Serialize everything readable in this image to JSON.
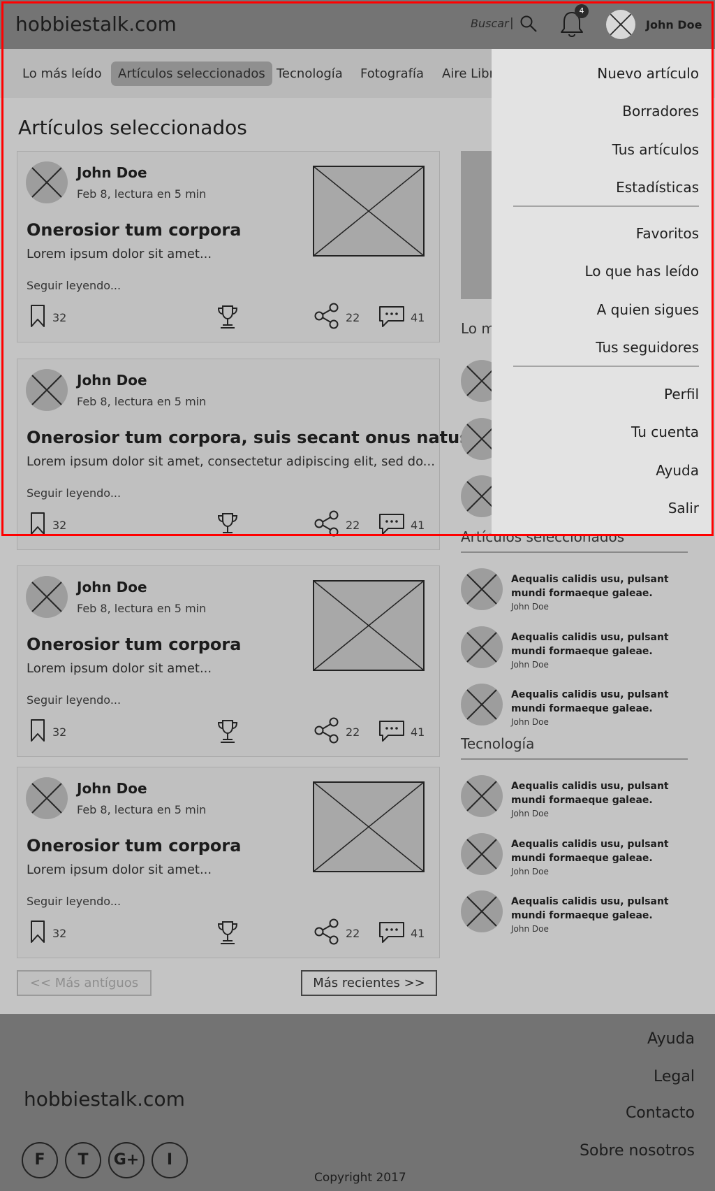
{
  "header": {
    "logo": "hobbiestalk.com",
    "search_label": "Buscar",
    "search_separator": "|",
    "notification_count": "4",
    "user_name": "John Doe"
  },
  "nav": {
    "items": [
      {
        "label": "Lo más leído",
        "active": false
      },
      {
        "label": "Artículos seleccionados",
        "active": true
      },
      {
        "label": "Tecnología",
        "active": false
      },
      {
        "label": "Fotografía",
        "active": false
      },
      {
        "label": "Aire Libre",
        "active": false
      }
    ]
  },
  "main": {
    "title": "Artículos seleccionados",
    "articles": [
      {
        "author": "John Doe",
        "meta": "Feb 8, lectura en 5 min",
        "title": "Onerosior tum corpora",
        "excerpt": "Lorem ipsum dolor sit amet...",
        "read_more": "Seguir leyendo...",
        "bookmarks": "32",
        "shares": "22",
        "comments": "41",
        "has_image": true
      },
      {
        "author": "John Doe",
        "meta": "Feb 8, lectura en 5 min",
        "title": "Onerosior tum corpora, suis secant onus natus",
        "excerpt": "Lorem ipsum dolor sit amet, consectetur adipiscing elit, sed do...",
        "read_more": "Seguir leyendo...",
        "bookmarks": "32",
        "shares": "22",
        "comments": "41",
        "has_image": false
      },
      {
        "author": "John Doe",
        "meta": "Feb 8, lectura en 5 min",
        "title": "Onerosior tum corpora",
        "excerpt": "Lorem ipsum dolor sit amet...",
        "read_more": "Seguir leyendo...",
        "bookmarks": "32",
        "shares": "22",
        "comments": "41",
        "has_image": true
      },
      {
        "author": "John Doe",
        "meta": "Feb 8, lectura en 5 min",
        "title": "Onerosior tum corpora",
        "excerpt": "Lorem ipsum dolor sit amet...",
        "read_more": "Seguir leyendo...",
        "bookmarks": "32",
        "shares": "22",
        "comments": "41",
        "has_image": true
      }
    ],
    "pagination": {
      "older": "<< Más antíguos",
      "newer": "Más recientes >>"
    }
  },
  "sidebar": {
    "sections": [
      {
        "heading": "Lo más leído",
        "items": []
      },
      {
        "heading": "Artículos seleccionados",
        "items": [
          {
            "title": "Aequalis calidis usu, pulsant mundi formaeque galeae.",
            "author": "John Doe"
          },
          {
            "title": "Aequalis calidis usu, pulsant mundi formaeque galeae.",
            "author": "John Doe"
          },
          {
            "title": "Aequalis calidis usu, pulsant mundi formaeque galeae.",
            "author": "John Doe"
          }
        ]
      },
      {
        "heading": "Tecnología",
        "items": [
          {
            "title": "Aequalis calidis usu, pulsant mundi formaeque galeae.",
            "author": "John Doe"
          },
          {
            "title": "Aequalis calidis usu, pulsant mundi formaeque galeae.",
            "author": "John Doe"
          },
          {
            "title": "Aequalis calidis usu, pulsant mundi formaeque galeae.",
            "author": "John Doe"
          }
        ]
      }
    ]
  },
  "user_menu": {
    "groups": [
      [
        "Nuevo artículo",
        "Borradores",
        "Tus artículos",
        "Estadísticas"
      ],
      [
        "Favoritos",
        "Lo que has leído",
        "A quien sigues",
        "Tus seguidores"
      ],
      [
        "Perfil",
        "Tu cuenta",
        "Ayuda",
        "Salir"
      ]
    ]
  },
  "footer": {
    "logo": "hobbiestalk.com",
    "links": [
      "Ayuda",
      "Legal",
      "Contacto",
      "Sobre nosotros"
    ],
    "social": [
      "F",
      "T",
      "G+",
      "I"
    ],
    "copyright": "Copyright 2017"
  },
  "colors": {
    "header_bg": "#747474",
    "nav_bg": "#b9b9b9",
    "page_bg": "#c4c4c4",
    "menu_bg": "#e3e3e3",
    "highlight_border": "#ff0000",
    "footer_bg": "#737373"
  }
}
